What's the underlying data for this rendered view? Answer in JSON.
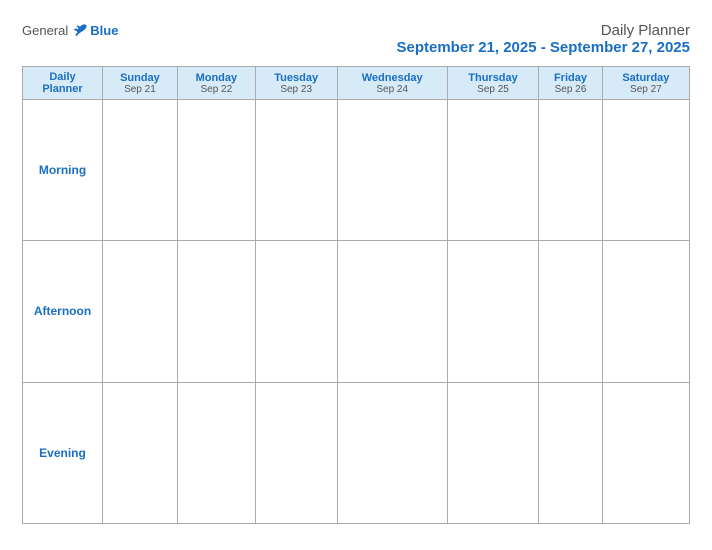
{
  "header": {
    "logo_general": "General",
    "logo_blue": "Blue",
    "title": "Daily Planner",
    "date_range": "September 21, 2025 - September 27, 2025"
  },
  "columns": [
    {
      "day": "Daily Planner",
      "date": ""
    },
    {
      "day": "Sunday",
      "date": "Sep 21"
    },
    {
      "day": "Monday",
      "date": "Sep 22"
    },
    {
      "day": "Tuesday",
      "date": "Sep 23"
    },
    {
      "day": "Wednesday",
      "date": "Sep 24"
    },
    {
      "day": "Thursday",
      "date": "Sep 25"
    },
    {
      "day": "Friday",
      "date": "Sep 26"
    },
    {
      "day": "Saturday",
      "date": "Sep 27"
    }
  ],
  "rows": [
    {
      "label": "Morning"
    },
    {
      "label": "Afternoon"
    },
    {
      "label": "Evening"
    }
  ]
}
